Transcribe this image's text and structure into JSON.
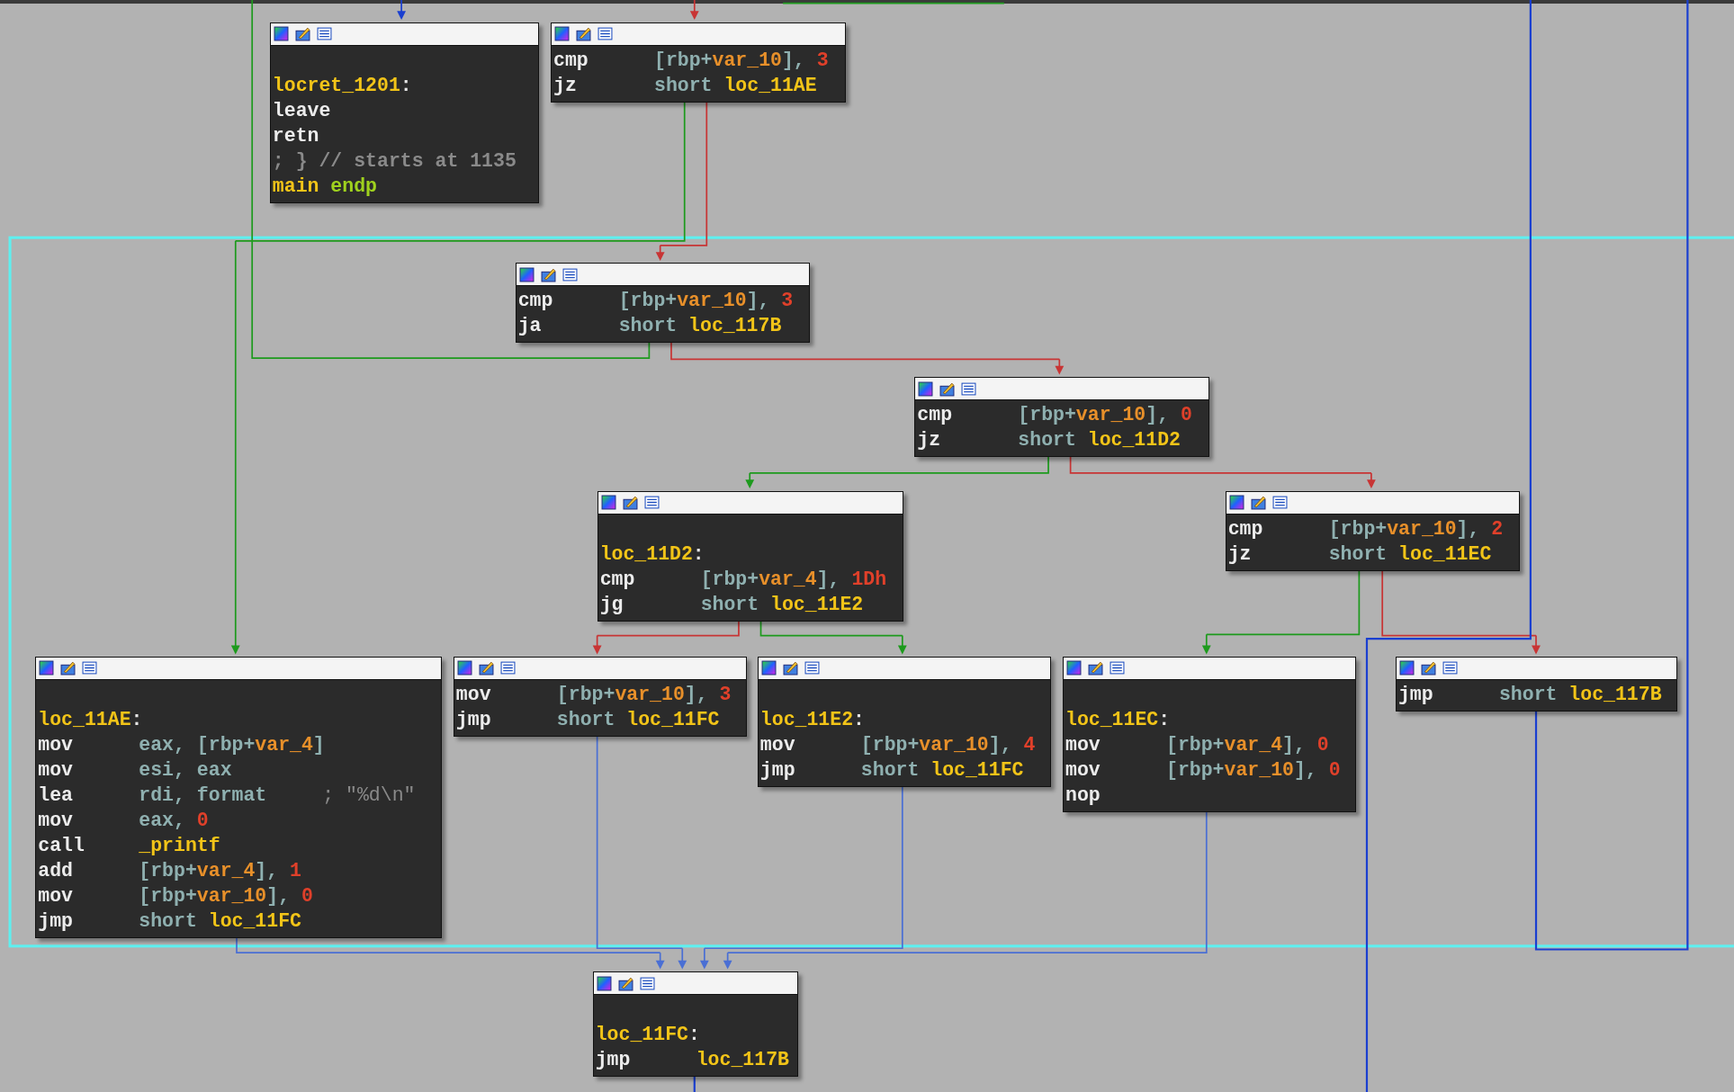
{
  "graph": {
    "nodes": [
      {
        "lines": [
          {
            "kind": "label",
            "operands": [
              {
                "kind": "name",
                "t": "locret_1201"
              },
              {
                "kind": "plain",
                "t": ":"
              }
            ]
          },
          {
            "kind": "instr",
            "mnemonic": "leave"
          },
          {
            "kind": "instr",
            "mnemonic": "retn"
          },
          {
            "kind": "comment",
            "operands": [
              {
                "kind": "cmt",
                "t": "; } // starts at 1135"
              }
            ]
          },
          {
            "kind": "directive",
            "operands": [
              {
                "kind": "name",
                "t": "main"
              },
              {
                "kind": "kw",
                "t": " endp"
              }
            ]
          }
        ]
      },
      {
        "lines": [
          {
            "kind": "instr",
            "mnemonic": "cmp",
            "operands": [
              {
                "kind": "reg",
                "t": "[rbp+"
              },
              {
                "kind": "var",
                "t": "var_10"
              },
              {
                "kind": "reg",
                "t": "], "
              },
              {
                "kind": "num",
                "t": "3"
              }
            ]
          },
          {
            "kind": "instr",
            "mnemonic": "jz",
            "operands": [
              {
                "kind": "reg",
                "t": "short "
              },
              {
                "kind": "name",
                "t": "loc_11AE"
              }
            ]
          }
        ]
      },
      {
        "lines": [
          {
            "kind": "instr",
            "mnemonic": "cmp",
            "operands": [
              {
                "kind": "reg",
                "t": "[rbp+"
              },
              {
                "kind": "var",
                "t": "var_10"
              },
              {
                "kind": "reg",
                "t": "], "
              },
              {
                "kind": "num",
                "t": "3"
              }
            ]
          },
          {
            "kind": "instr",
            "mnemonic": "ja",
            "operands": [
              {
                "kind": "reg",
                "t": "short "
              },
              {
                "kind": "name",
                "t": "loc_117B"
              }
            ]
          }
        ]
      },
      {
        "lines": [
          {
            "kind": "instr",
            "mnemonic": "cmp",
            "operands": [
              {
                "kind": "reg",
                "t": "[rbp+"
              },
              {
                "kind": "var",
                "t": "var_10"
              },
              {
                "kind": "reg",
                "t": "], "
              },
              {
                "kind": "num",
                "t": "0"
              }
            ]
          },
          {
            "kind": "instr",
            "mnemonic": "jz",
            "operands": [
              {
                "kind": "reg",
                "t": "short "
              },
              {
                "kind": "name",
                "t": "loc_11D2"
              }
            ]
          }
        ]
      },
      {
        "lines": [
          {
            "kind": "label",
            "operands": [
              {
                "kind": "name",
                "t": "loc_11D2"
              },
              {
                "kind": "plain",
                "t": ":"
              }
            ]
          },
          {
            "kind": "instr",
            "mnemonic": "cmp",
            "operands": [
              {
                "kind": "reg",
                "t": "[rbp+"
              },
              {
                "kind": "var",
                "t": "var_4"
              },
              {
                "kind": "reg",
                "t": "], "
              },
              {
                "kind": "num",
                "t": "1Dh"
              }
            ]
          },
          {
            "kind": "instr",
            "mnemonic": "jg",
            "operands": [
              {
                "kind": "reg",
                "t": "short "
              },
              {
                "kind": "name",
                "t": "loc_11E2"
              }
            ]
          }
        ]
      },
      {
        "lines": [
          {
            "kind": "instr",
            "mnemonic": "cmp",
            "operands": [
              {
                "kind": "reg",
                "t": "[rbp+"
              },
              {
                "kind": "var",
                "t": "var_10"
              },
              {
                "kind": "reg",
                "t": "], "
              },
              {
                "kind": "num",
                "t": "2"
              }
            ]
          },
          {
            "kind": "instr",
            "mnemonic": "jz",
            "operands": [
              {
                "kind": "reg",
                "t": "short "
              },
              {
                "kind": "name",
                "t": "loc_11EC"
              }
            ]
          }
        ]
      },
      {
        "lines": [
          {
            "kind": "label",
            "operands": [
              {
                "kind": "name",
                "t": "loc_11AE"
              },
              {
                "kind": "plain",
                "t": ":"
              }
            ]
          },
          {
            "kind": "instr",
            "mnemonic": "mov",
            "operands": [
              {
                "kind": "reg",
                "t": "eax, [rbp+"
              },
              {
                "kind": "var",
                "t": "var_4"
              },
              {
                "kind": "reg",
                "t": "]"
              }
            ]
          },
          {
            "kind": "instr",
            "mnemonic": "mov",
            "operands": [
              {
                "kind": "reg",
                "t": "esi, eax"
              }
            ]
          },
          {
            "kind": "instr",
            "mnemonic": "lea",
            "operands": [
              {
                "kind": "reg",
                "t": "rdi, format"
              },
              {
                "kind": "cmt",
                "t": "; \"%d\\n\""
              }
            ]
          },
          {
            "kind": "instr",
            "mnemonic": "mov",
            "operands": [
              {
                "kind": "reg",
                "t": "eax, "
              },
              {
                "kind": "num",
                "t": "0"
              }
            ]
          },
          {
            "kind": "instr",
            "mnemonic": "call",
            "operands": [
              {
                "kind": "name",
                "t": "_printf"
              }
            ]
          },
          {
            "kind": "instr",
            "mnemonic": "add",
            "operands": [
              {
                "kind": "reg",
                "t": "[rbp+"
              },
              {
                "kind": "var",
                "t": "var_4"
              },
              {
                "kind": "reg",
                "t": "], "
              },
              {
                "kind": "num",
                "t": "1"
              }
            ]
          },
          {
            "kind": "instr",
            "mnemonic": "mov",
            "operands": [
              {
                "kind": "reg",
                "t": "[rbp+"
              },
              {
                "kind": "var",
                "t": "var_10"
              },
              {
                "kind": "reg",
                "t": "], "
              },
              {
                "kind": "num",
                "t": "0"
              }
            ]
          },
          {
            "kind": "instr",
            "mnemonic": "jmp",
            "operands": [
              {
                "kind": "reg",
                "t": "short "
              },
              {
                "kind": "name",
                "t": "loc_11FC"
              }
            ]
          }
        ]
      },
      {
        "lines": [
          {
            "kind": "instr",
            "mnemonic": "mov",
            "operands": [
              {
                "kind": "reg",
                "t": "[rbp+"
              },
              {
                "kind": "var",
                "t": "var_10"
              },
              {
                "kind": "reg",
                "t": "], "
              },
              {
                "kind": "num",
                "t": "3"
              }
            ]
          },
          {
            "kind": "instr",
            "mnemonic": "jmp",
            "operands": [
              {
                "kind": "reg",
                "t": "short "
              },
              {
                "kind": "name",
                "t": "loc_11FC"
              }
            ]
          }
        ]
      },
      {
        "lines": [
          {
            "kind": "label",
            "operands": [
              {
                "kind": "name",
                "t": "loc_11E2"
              },
              {
                "kind": "plain",
                "t": ":"
              }
            ]
          },
          {
            "kind": "instr",
            "mnemonic": "mov",
            "operands": [
              {
                "kind": "reg",
                "t": "[rbp+"
              },
              {
                "kind": "var",
                "t": "var_10"
              },
              {
                "kind": "reg",
                "t": "], "
              },
              {
                "kind": "num",
                "t": "4"
              }
            ]
          },
          {
            "kind": "instr",
            "mnemonic": "jmp",
            "operands": [
              {
                "kind": "reg",
                "t": "short "
              },
              {
                "kind": "name",
                "t": "loc_11FC"
              }
            ]
          }
        ]
      },
      {
        "lines": [
          {
            "kind": "label",
            "operands": [
              {
                "kind": "name",
                "t": "loc_11EC"
              },
              {
                "kind": "plain",
                "t": ":"
              }
            ]
          },
          {
            "kind": "instr",
            "mnemonic": "mov",
            "operands": [
              {
                "kind": "reg",
                "t": "[rbp+"
              },
              {
                "kind": "var",
                "t": "var_4"
              },
              {
                "kind": "reg",
                "t": "], "
              },
              {
                "kind": "num",
                "t": "0"
              }
            ]
          },
          {
            "kind": "instr",
            "mnemonic": "mov",
            "operands": [
              {
                "kind": "reg",
                "t": "[rbp+"
              },
              {
                "kind": "var",
                "t": "var_10"
              },
              {
                "kind": "reg",
                "t": "], "
              },
              {
                "kind": "num",
                "t": "0"
              }
            ]
          },
          {
            "kind": "instr",
            "mnemonic": "nop"
          }
        ]
      },
      {
        "lines": [
          {
            "kind": "instr",
            "mnemonic": "jmp",
            "operands": [
              {
                "kind": "reg",
                "t": "short "
              },
              {
                "kind": "name",
                "t": "loc_117B"
              }
            ]
          }
        ]
      },
      {
        "lines": [
          {
            "kind": "label",
            "operands": [
              {
                "kind": "name",
                "t": "loc_11FC"
              },
              {
                "kind": "plain",
                "t": ":"
              }
            ]
          },
          {
            "kind": "instr",
            "mnemonic": "jmp",
            "operands": [
              {
                "kind": "name",
                "t": "loc_117B"
              }
            ]
          }
        ]
      }
    ]
  }
}
